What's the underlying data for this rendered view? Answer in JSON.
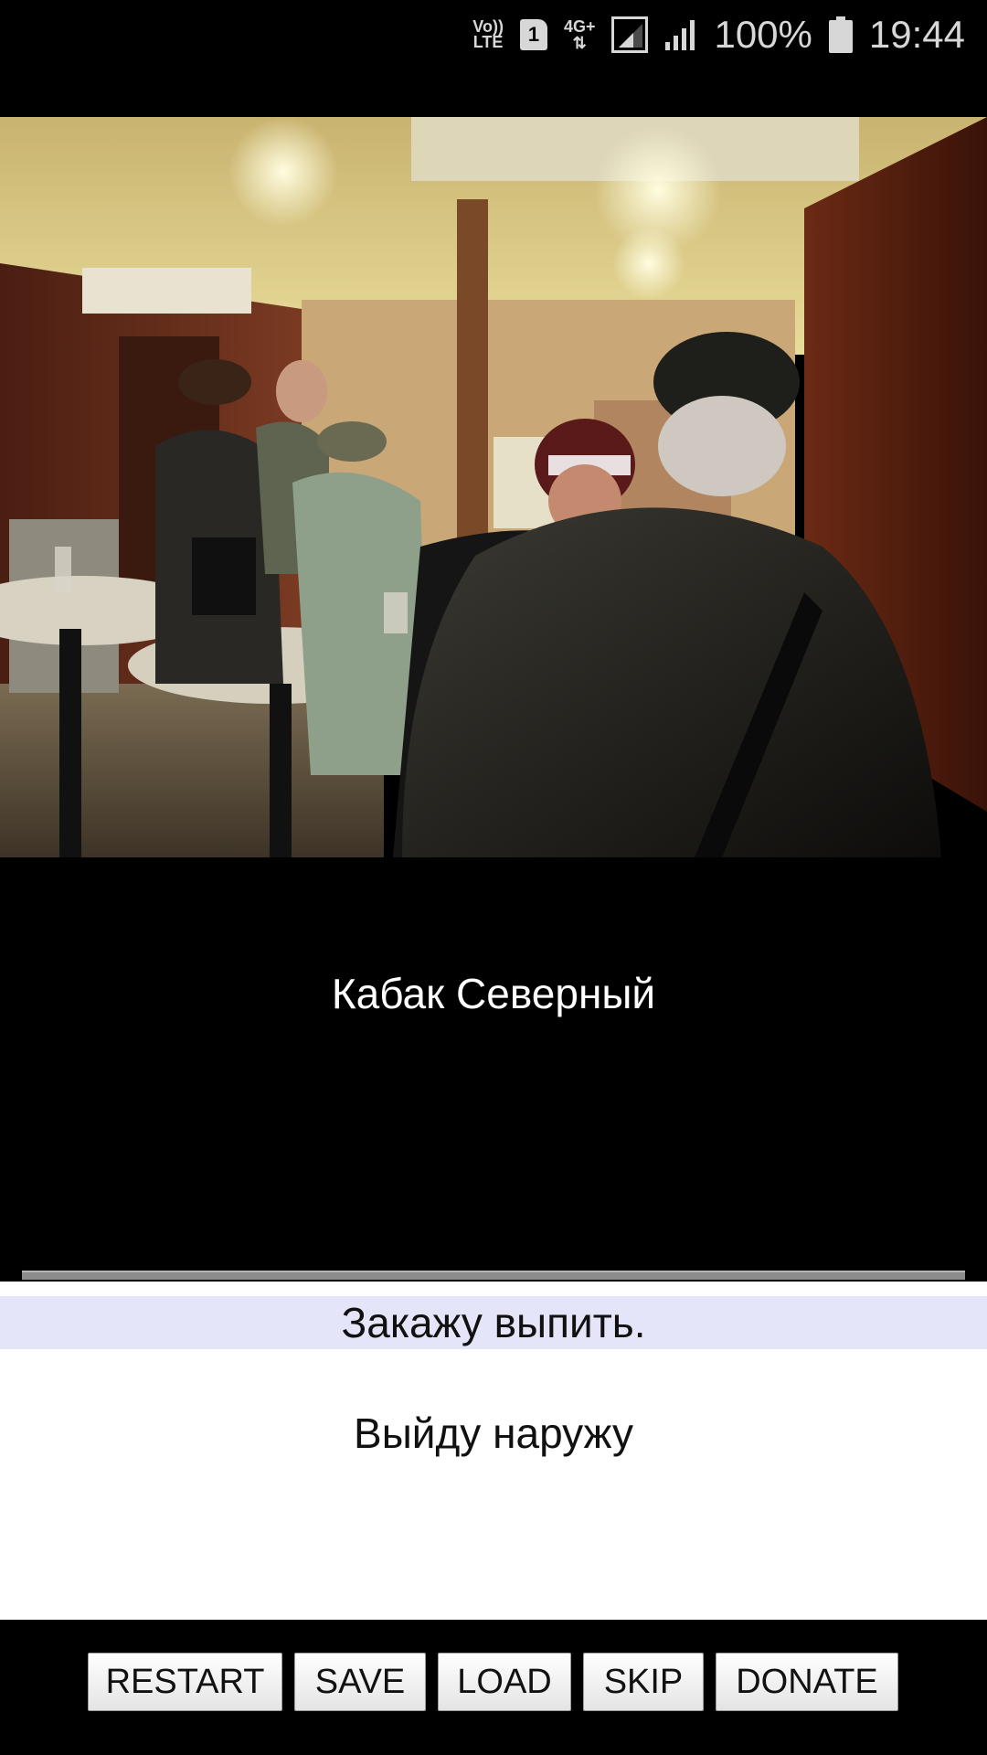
{
  "status_bar": {
    "volte_top": "Vo))",
    "volte_bottom": "LTE",
    "sim_slot": "1",
    "network_type": "4G+",
    "network_arrows": "⇅",
    "battery_percent": "100%",
    "time": "19:44"
  },
  "scene": {
    "image_icon": "scene-photo-bar-interior",
    "location_title": "Кабак Северный"
  },
  "choices": [
    {
      "label": "Закажу выпить."
    },
    {
      "label": "Выйду наружу"
    }
  ],
  "buttons": {
    "restart": "RESTART",
    "save": "SAVE",
    "load": "LOAD",
    "skip": "SKIP",
    "donate": "DONATE"
  },
  "colors": {
    "background": "#000000",
    "choice_highlight": "#e5e5fa",
    "choices_panel": "#ffffff"
  }
}
